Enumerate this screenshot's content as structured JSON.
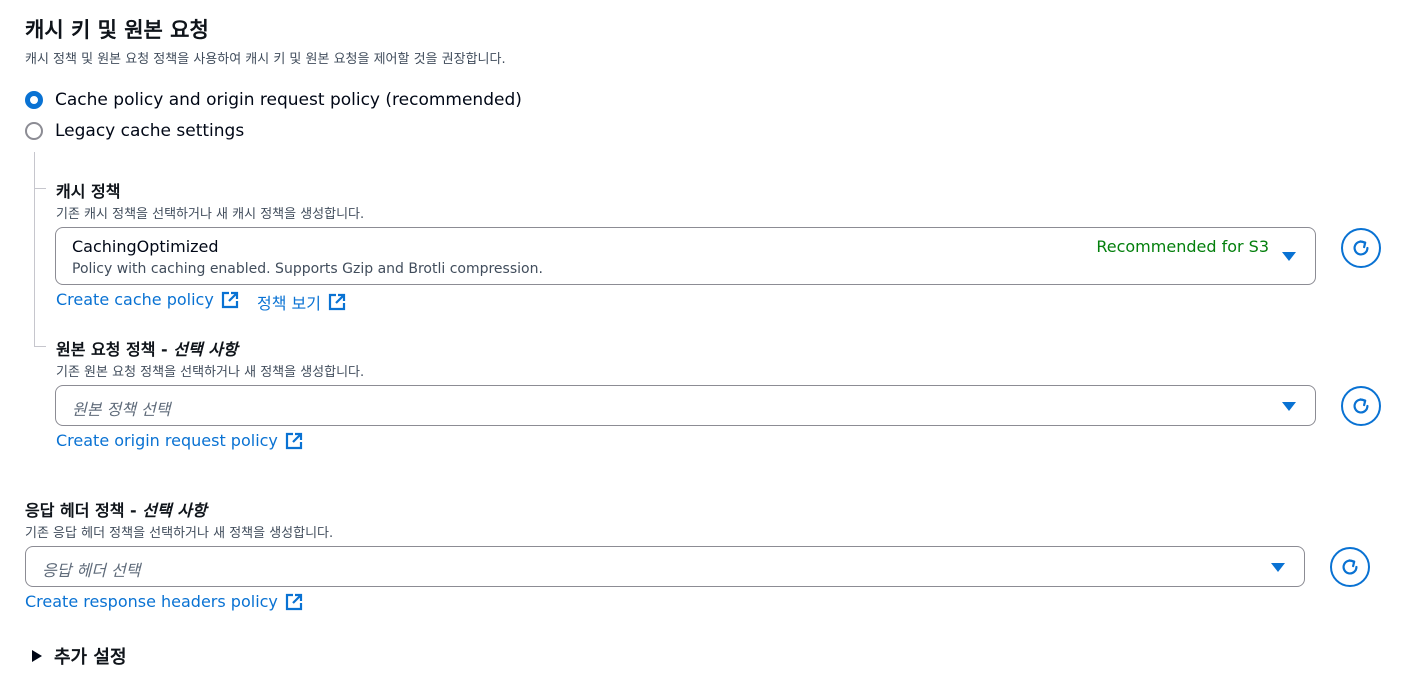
{
  "section": {
    "title": "캐시 키 및 원본 요청",
    "description": "캐시 정책 및 원본 요청 정책을 사용하여 캐시 키 및 원본 요청을 제어할 것을 권장합니다."
  },
  "radios": [
    {
      "label": "Cache policy and origin request policy (recommended)",
      "checked": true
    },
    {
      "label": "Legacy cache settings",
      "checked": false
    }
  ],
  "cache_policy": {
    "label": "캐시 정책",
    "description": "기존 캐시 정책을 선택하거나 새 캐시 정책을 생성합니다.",
    "selected_value": "CachingOptimized",
    "selected_description": "Policy with caching enabled. Supports Gzip and Brotli compression.",
    "tag": "Recommended for S3",
    "links": [
      "Create cache policy",
      "정책 보기"
    ]
  },
  "origin_request_policy": {
    "label": "원본 요청 정책 - ",
    "label_optional": "선택 사항",
    "description": "기존 원본 요청 정책을 선택하거나 새 정책을 생성합니다.",
    "placeholder": "원본 정책 선택",
    "link": "Create origin request policy"
  },
  "response_headers_policy": {
    "label": "응답 헤더 정책 - ",
    "label_optional": "선택 사항",
    "description": "기존 응답 헤더 정책을 선택하거나 새 정책을 생성합니다.",
    "placeholder": "응답 헤더 선택",
    "link": "Create response headers policy"
  },
  "additional_settings": {
    "label": "추가 설정"
  },
  "colors": {
    "accent": "#0972d3",
    "success": "#037f0c",
    "text": "#000716",
    "border": "#8c8c94"
  },
  "icons": [
    "external-link-icon",
    "refresh-icon",
    "caret-down-icon",
    "caret-right-icon"
  ]
}
